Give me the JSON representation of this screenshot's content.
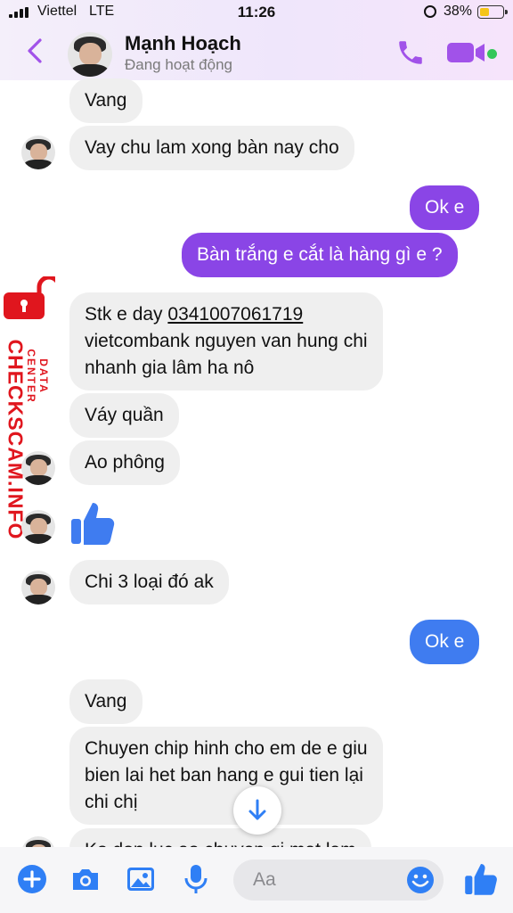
{
  "status_bar": {
    "carrier": "Viettel",
    "network": "LTE",
    "time": "11:26",
    "battery": "38%"
  },
  "header": {
    "name": "Mạnh Hoạch",
    "status": "Đang hoạt động",
    "accent": "#a152e9"
  },
  "messages": [
    {
      "side": "in",
      "text": "Vang"
    },
    {
      "side": "in",
      "text": "Vay chu lam xong bàn nay cho"
    },
    {
      "side": "out",
      "text": "Ok e"
    },
    {
      "side": "out",
      "text": "Bàn trắng e cắt là hàng gì e ?"
    },
    {
      "side": "in",
      "line1_prefix": "Stk e day ",
      "account": "0341007061719",
      "line2": "vietcombank nguyen van hung chi",
      "line3": "nhanh gia lâm ha nô"
    },
    {
      "side": "in",
      "text": "Váy quần"
    },
    {
      "side": "in",
      "text": "Ao phông"
    },
    {
      "side": "in",
      "type": "like",
      "icon": "thumbs-up-icon"
    },
    {
      "side": "in",
      "text": "Chi 3 loại đó ak"
    },
    {
      "side": "out",
      "text": "Ok e"
    },
    {
      "side": "in",
      "text": "Vang"
    },
    {
      "side": "in",
      "line1": "Chuyen chip hinh cho em de e giu",
      "line2": "bien lai het ban hang e gui tien lại",
      "line3": "chi chị"
    },
    {
      "side": "in",
      "text": "Ko don luc ao chuyen gi mat lam"
    }
  ],
  "watermark": {
    "brand": "CHECKSCAM.INFO",
    "tagline": "DATA CENTER"
  },
  "composer": {
    "placeholder": "Aa"
  },
  "colors": {
    "outgoing_purple": "#8a45e6",
    "outgoing_blue": "#3f7cf0",
    "incoming": "#efefef",
    "composer_icons": "#2f7ff5"
  }
}
